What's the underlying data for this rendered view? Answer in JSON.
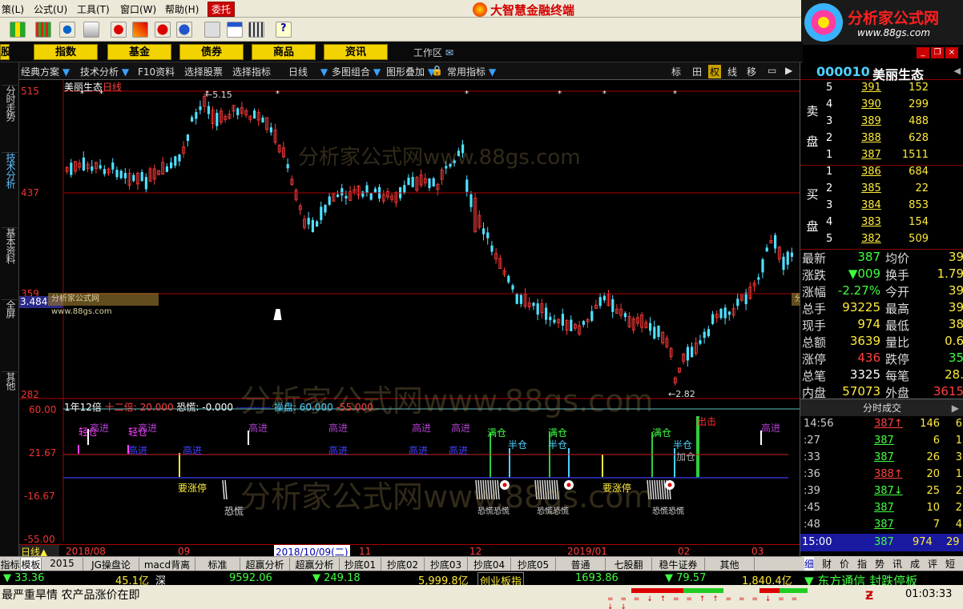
{
  "menu": {
    "items": [
      "策(L)",
      "公式(U)",
      "工具(T)",
      "窗口(W)",
      "帮助(H)"
    ],
    "entrust": "委托",
    "app_title": "大智慧金融终端"
  },
  "brand": {
    "title": "分析家公式网",
    "url": "www.88gs.com"
  },
  "category_bar": {
    "buttons": [
      "股",
      "指数",
      "基金",
      "债券",
      "商品",
      "资讯"
    ],
    "workarea": "工作区"
  },
  "left_tabs": [
    "分时走势",
    "技术分析",
    "基本资料",
    "全屏",
    "其他"
  ],
  "chart_toolbar": {
    "items": [
      "经典方案",
      "技术分析",
      "F10资料",
      "选择股票",
      "选择指标",
      "日线",
      "多图组合",
      "图形叠加",
      "常用指标"
    ],
    "right_items": [
      "标",
      "田",
      "权",
      "线",
      "移"
    ]
  },
  "chart": {
    "stock_label": "美丽生态",
    "period_label": "日线",
    "y_labels": [
      "515",
      "437",
      "359",
      "282"
    ],
    "cursor_value": "3.484",
    "high_mark": "5.15",
    "low_mark": "2.82",
    "watermark": "分析家公式网www.88gs.com",
    "watermark_small": "分析家公式网www.88gs.com"
  },
  "indicator": {
    "header_parts": [
      "1年12倍",
      "十二倍: 20.000",
      "恐慌: -0.000",
      "操盘: 60.000",
      "-55.000"
    ],
    "y_labels": [
      "60.00",
      "21.67",
      "-16.67",
      "-55.00"
    ],
    "signals": [
      "轻仓",
      "轻仓",
      "高进",
      "高进",
      "高进",
      "高进",
      "高进",
      "高进",
      "高进",
      "高进",
      "高进",
      "高进",
      "高进",
      "高进",
      "满仓",
      "满仓",
      "满仓",
      "半仓",
      "半仓",
      "半仓",
      "加仓",
      "出击",
      "要涨停",
      "要涨停",
      "恐慌",
      "恐慌恐慌",
      "恐慌恐慌",
      "恐慌恐慌"
    ]
  },
  "time_axis": {
    "labels": [
      "2018/08",
      "09",
      "2018/10/09(二)",
      "11",
      "12",
      "2019/01",
      "02",
      "03"
    ],
    "period": "日线"
  },
  "stock": {
    "code": "000010",
    "name": "美丽生态"
  },
  "order_book": {
    "sell_label": [
      "卖",
      "盘"
    ],
    "buy_label": [
      "买",
      "盘"
    ],
    "sells": [
      {
        "level": "5",
        "price": "391",
        "volume": "152"
      },
      {
        "level": "4",
        "price": "390",
        "volume": "299"
      },
      {
        "level": "3",
        "price": "389",
        "volume": "488"
      },
      {
        "level": "2",
        "price": "388",
        "volume": "628"
      },
      {
        "level": "1",
        "price": "387",
        "volume": "1511"
      }
    ],
    "buys": [
      {
        "level": "1",
        "price": "386",
        "volume": "684"
      },
      {
        "level": "2",
        "price": "385",
        "volume": "22"
      },
      {
        "level": "3",
        "price": "384",
        "volume": "853"
      },
      {
        "level": "4",
        "price": "383",
        "volume": "154"
      },
      {
        "level": "5",
        "price": "382",
        "volume": "509"
      }
    ]
  },
  "quote": {
    "rows": [
      {
        "k1": "最新",
        "v1": "387",
        "k2": "均价",
        "v2": "39"
      },
      {
        "k1": "涨跌",
        "v1": "▼009",
        "k2": "换手",
        "v2": "1.79"
      },
      {
        "k1": "涨幅",
        "v1": "-2.27%",
        "k2": "今开",
        "v2": "39"
      },
      {
        "k1": "总手",
        "v1": "93225",
        "k2": "最高",
        "v2": "39"
      },
      {
        "k1": "现手",
        "v1": "974",
        "k2": "最低",
        "v2": "38"
      },
      {
        "k1": "总额",
        "v1": "3639",
        "k2": "量比",
        "v2": "0.6"
      },
      {
        "k1": "涨停",
        "v1": "436",
        "k2": "跌停",
        "v2": "35"
      },
      {
        "k1": "总笔",
        "v1": "3325",
        "k2": "每笔",
        "v2": "28."
      },
      {
        "k1": "内盘",
        "v1": "57073",
        "k2": "外盘",
        "v2": "3615"
      }
    ]
  },
  "fenshi": {
    "header": "分时成交",
    "rows": [
      {
        "time": "14:56",
        "price": "387↑",
        "vol": "146",
        "cnt": "6"
      },
      {
        "time": ":27",
        "price": "387",
        "vol": "6",
        "cnt": "1"
      },
      {
        "time": ":33",
        "price": "387",
        "vol": "26",
        "cnt": "3"
      },
      {
        "time": ":36",
        "price": "388↑",
        "vol": "20",
        "cnt": "1"
      },
      {
        "time": ":39",
        "price": "387↓",
        "vol": "25",
        "cnt": "2"
      },
      {
        "time": ":45",
        "price": "387",
        "vol": "10",
        "cnt": "2"
      },
      {
        "time": ":48",
        "price": "387",
        "vol": "7",
        "cnt": "4"
      }
    ],
    "footer": {
      "time": "15:00",
      "price": "387",
      "vol": "974",
      "cnt": "29"
    }
  },
  "bottom_tabs": [
    "指标",
    "模板",
    "2015",
    "JG操盘论",
    "macd背离",
    "标准",
    "超赢分析",
    "超赢分析",
    "抄底01",
    "抄底02",
    "抄底03",
    "抄底04",
    "抄底05",
    "普通",
    "七股翻",
    "稳牛证券",
    "其他"
  ],
  "right_tabs": [
    "细",
    "财",
    "价",
    "指",
    "势",
    "讯",
    "成",
    "评",
    "短"
  ],
  "index_bar": {
    "items": [
      "▼ 33.36",
      "45.1亿",
      "深",
      "9592.06",
      "▼ 249.18",
      "5,999.8亿",
      "创业板指",
      "1693.86",
      "▼ 79.57",
      "1,840.4亿",
      "▼ 东方通信 封跌停板"
    ]
  },
  "status": {
    "text": "最严重旱情 农产品涨价在即",
    "clock": "01:03:33"
  }
}
